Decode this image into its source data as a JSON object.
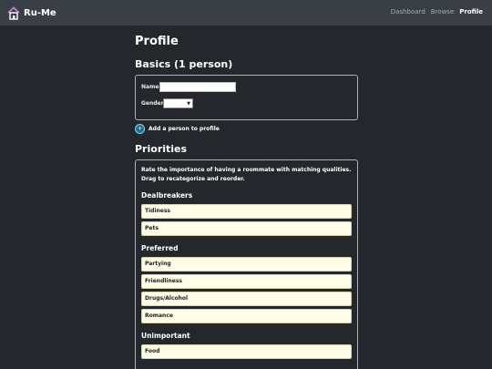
{
  "nav": {
    "brand": "Ru-Me",
    "links": [
      {
        "label": "Dashboard"
      },
      {
        "label": "Browse"
      },
      {
        "label": "Profile",
        "active": true
      }
    ]
  },
  "page": {
    "title": "Profile",
    "basics_heading": "Basics (1 person)",
    "name_label": "Name",
    "name_value": "",
    "gender_label": "Gender",
    "gender_value": "",
    "add_person": "Add a person to profile",
    "priorities_heading": "Priorities",
    "priorities_description": "Rate the importance of having a roommate with matching qualities. Drag to recategorize and reorder."
  },
  "priorities": {
    "dealbreakers": {
      "title": "Dealbreakers",
      "items": [
        "Tidiness",
        "Pets"
      ]
    },
    "preferred": {
      "title": "Preferred",
      "items": [
        "Partying",
        "Friendliness",
        "Drugs/Alcohol",
        "Romance"
      ]
    },
    "unimportant": {
      "title": "Unimportant",
      "items": [
        "Food"
      ]
    }
  },
  "colors": {
    "background": "#24282c",
    "navbar": "#3a3f45",
    "item_bg": "#fffde6",
    "accent": "#1c6f91"
  }
}
